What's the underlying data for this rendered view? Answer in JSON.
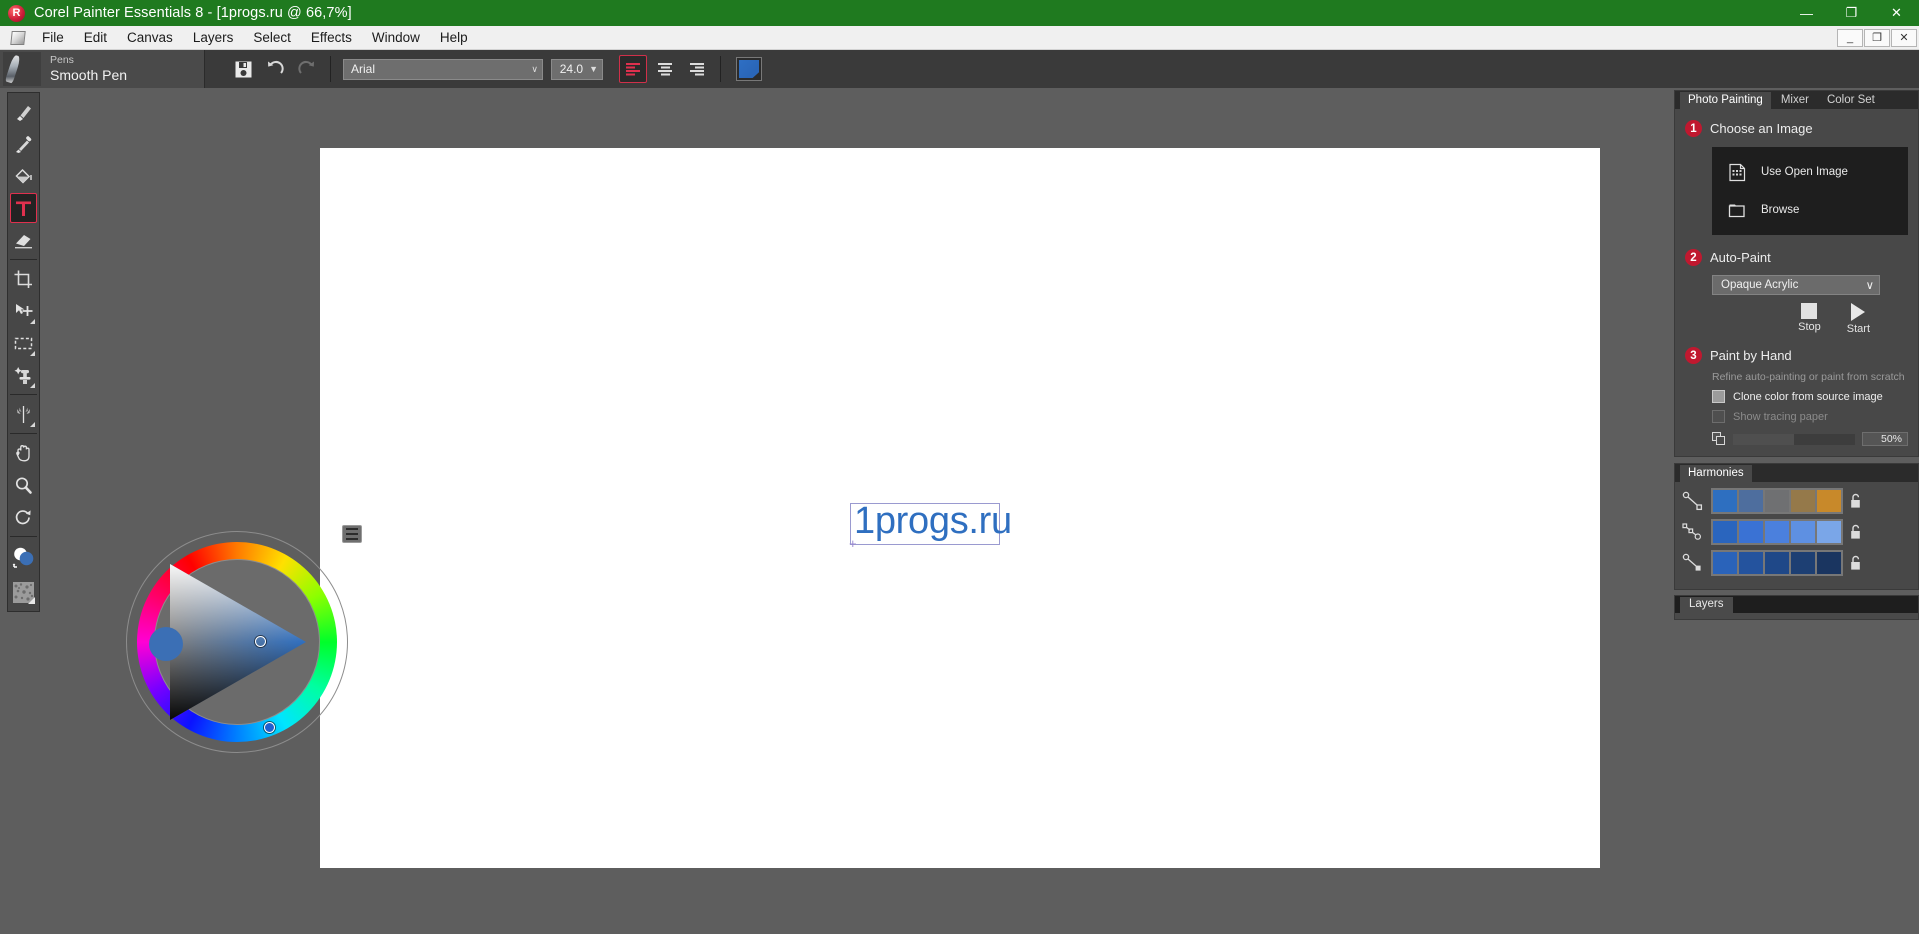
{
  "window": {
    "title": "Corel Painter Essentials 8 - [1progs.ru @ 66,7%]",
    "logo_icon": "corel-logo-icon",
    "minimize": "—",
    "restore": "❐",
    "close": "✕",
    "doc_minimize": "_",
    "doc_restore": "❐",
    "doc_close": "✕"
  },
  "menu": {
    "doc_icon": "document-icon",
    "items": [
      {
        "label": "File"
      },
      {
        "label": "Edit"
      },
      {
        "label": "Canvas"
      },
      {
        "label": "Layers"
      },
      {
        "label": "Select"
      },
      {
        "label": "Effects"
      },
      {
        "label": "Window"
      },
      {
        "label": "Help"
      }
    ]
  },
  "propertybar": {
    "brush_category": "Pens",
    "brush_name": "Smooth Pen",
    "save_icon": "save-icon",
    "undo_icon": "undo-icon",
    "redo_icon": "redo-icon",
    "font": {
      "value": "Arial",
      "chevron": "∨"
    },
    "size": {
      "value": "24.0",
      "chevron": "▼"
    },
    "align_left_icon": "align-left-icon",
    "align_center_icon": "align-center-icon",
    "align_right_icon": "align-right-icon",
    "color_swatch_icon": "text-color-swatch-icon",
    "text_color": "#2a66b8"
  },
  "toolbox": {
    "tools": [
      {
        "name": "brush-tool",
        "selected": false
      },
      {
        "name": "dropper-tool",
        "selected": false
      },
      {
        "name": "paint-bucket-tool",
        "selected": false
      },
      {
        "name": "text-tool",
        "selected": true
      },
      {
        "name": "eraser-tool",
        "selected": false
      },
      {
        "name": "crop-tool",
        "selected": false
      },
      {
        "name": "move-tool",
        "selected": false
      },
      {
        "name": "rectangular-selection-tool",
        "selected": false
      },
      {
        "name": "clone-stamp-tool",
        "selected": false
      },
      {
        "name": "mirror-painting-tool",
        "selected": false
      },
      {
        "name": "hand-tool",
        "selected": false
      },
      {
        "name": "magnifier-tool",
        "selected": false
      },
      {
        "name": "rotate-page-tool",
        "selected": false
      }
    ],
    "primary_color": "#3b6fb5",
    "secondary_color": "#ffffff",
    "paper_texture_icon": "paper-texture-icon",
    "swap_colors_icon": "swap-colors-icon"
  },
  "canvas": {
    "text_layer": "1progs.ru",
    "text_color": "#2f6fc0",
    "caret_icon": "text-caret-icon"
  },
  "colorwheel": {
    "menu_icon": "panel-menu-icon",
    "preview_color": "#3b6fb5",
    "triangle_marker_icon": "saturation-marker-icon",
    "ring_marker_icon": "hue-marker-icon"
  },
  "panels": {
    "tabs": [
      {
        "label": "Photo Painting",
        "active": true
      },
      {
        "label": "Mixer",
        "active": false
      },
      {
        "label": "Color Set",
        "active": false
      }
    ],
    "photo_painting": {
      "step1": {
        "number": "1",
        "title": "Choose an Image",
        "use_open_image": {
          "label": "Use Open Image",
          "icon": "use-open-image-icon"
        },
        "browse": {
          "label": "Browse",
          "icon": "folder-icon"
        }
      },
      "step2": {
        "number": "2",
        "title": "Auto-Paint",
        "style": {
          "value": "Opaque Acrylic",
          "chevron": "∨"
        },
        "stop": {
          "label": "Stop",
          "icon": "stop-icon"
        },
        "start": {
          "label": "Start",
          "icon": "play-icon"
        }
      },
      "step3": {
        "number": "3",
        "title": "Paint by Hand",
        "note": "Refine auto-painting or paint from scratch",
        "clone_color": {
          "label": "Clone color from source image",
          "checked": false,
          "enabled": true
        },
        "tracing_paper": {
          "label": "Show tracing paper",
          "checked": false,
          "enabled": false
        },
        "opacity": {
          "value": "50%",
          "percent": 50,
          "icon": "tracing-paper-opacity-icon"
        }
      }
    },
    "harmonies": {
      "tab": "Harmonies",
      "rows": [
        {
          "glyph": "harmony-complementary-icon",
          "lock_icon": "unlock-icon",
          "swatches": [
            "#2e6fc0",
            "#4e6e9e",
            "#6f7072",
            "#95794a",
            "#c8892a"
          ]
        },
        {
          "glyph": "harmony-triadic-icon",
          "lock_icon": "unlock-icon",
          "swatches": [
            "#2a65be",
            "#3a72d4",
            "#4b80dd",
            "#5e90e2",
            "#7aa6e8"
          ]
        },
        {
          "glyph": "harmony-analogous-icon",
          "lock_icon": "unlock-icon",
          "swatches": [
            "#2a63ba",
            "#24539e",
            "#1f4888",
            "#1d3f73",
            "#1a3560"
          ]
        }
      ]
    },
    "layers": {
      "tab": "Layers"
    }
  }
}
